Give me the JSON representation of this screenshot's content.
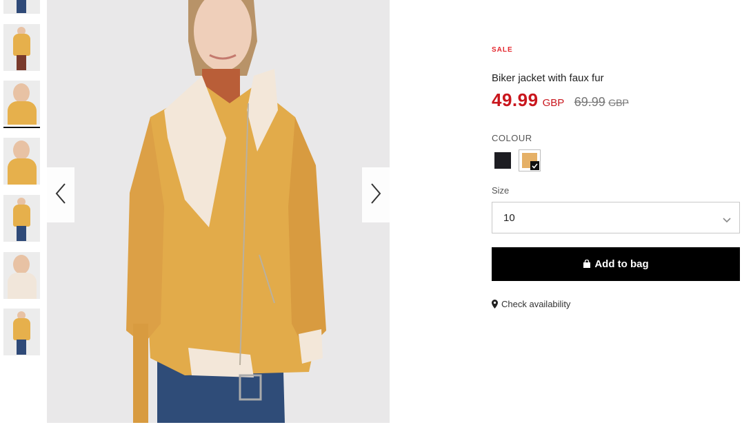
{
  "product": {
    "sale_tag": "SALE",
    "name": "Biker jacket with faux fur",
    "price_now": "49.99",
    "currency_now": "GBP",
    "price_old": "69.99",
    "currency_old": "GBP"
  },
  "colour": {
    "label": "COLOUR",
    "options": [
      {
        "name": "black",
        "hex": "#1d1d22",
        "selected": false
      },
      {
        "name": "camel",
        "hex": "#e5b066",
        "selected": true
      }
    ]
  },
  "size": {
    "label": "Size",
    "selected": "10"
  },
  "actions": {
    "add_to_bag": "Add to bag",
    "check_availability": "Check availability"
  },
  "gallery": {
    "thumbnail_count": 7,
    "active_thumbnail": 3,
    "icons": [
      "chevron-left-icon",
      "chevron-right-icon"
    ]
  },
  "colors": {
    "sale_red": "#c9161d",
    "button_bg": "#000000",
    "jacket": "#e6b04c"
  }
}
